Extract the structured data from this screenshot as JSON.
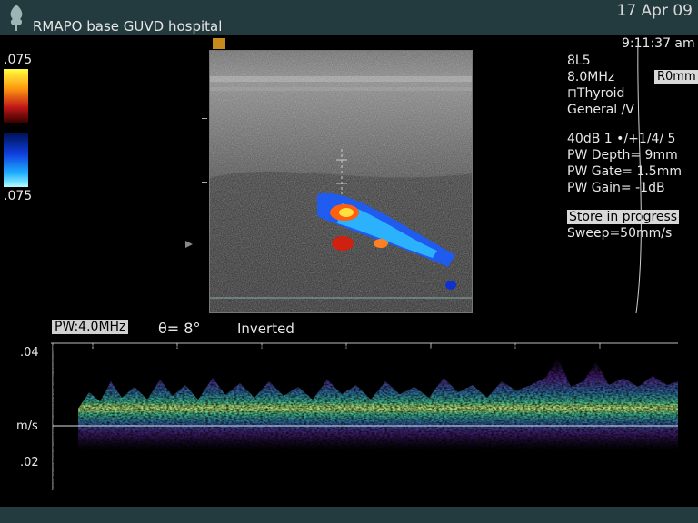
{
  "header": {
    "hospital": "RMAPO base GUVD hospital",
    "date": "17 Apr 09",
    "logo_icon": "tree-logo-icon"
  },
  "color_scale": {
    "top_value": ".075",
    "bottom_value": ".075"
  },
  "info": {
    "time": "9:11:37 am",
    "probe": "8L5",
    "frequency": "8.0MHz",
    "preset": "⊓Thyroid",
    "mode": "General /V",
    "r0": "R0mm",
    "gain_line": "40dB  1 •/+1/4/ 5",
    "pw_depth": "PW Depth=   9mm",
    "pw_gate": "PW Gate=  1.5mm",
    "pw_gain": "PW Gain=  -1dB",
    "store": "Store in progress",
    "sweep": "Sweep=50mm/s"
  },
  "doppler": {
    "pw_freq": "PW:4.0MHz",
    "angle": "θ= 8°",
    "inverted": "Inverted",
    "axis_top": ".04",
    "axis_unit": "m/s",
    "axis_bottom": ".02"
  },
  "colors": {
    "header_bg": "#233a3f",
    "doppler_warm": "#ff6010",
    "doppler_cool": "#1a5cff"
  }
}
